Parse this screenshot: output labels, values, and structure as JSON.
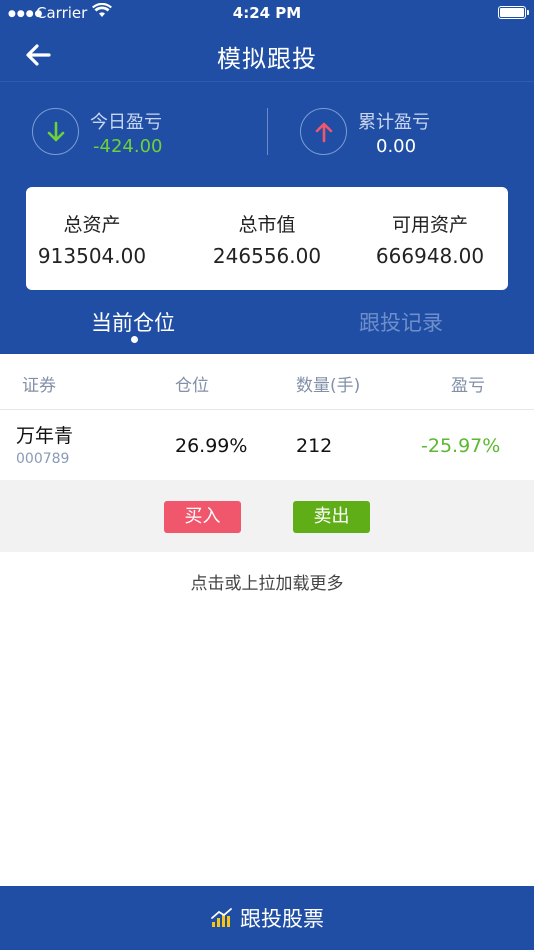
{
  "status_bar": {
    "carrier": "Carrier",
    "time": "4:24 PM"
  },
  "header": {
    "title": "模拟跟投"
  },
  "profit": {
    "today": {
      "label": "今日盈亏",
      "value": "-424.00",
      "icon": "arrow-down-icon",
      "color": "#6dd13a"
    },
    "total": {
      "label": "累计盈亏",
      "value": "0.00",
      "icon": "arrow-up-icon",
      "color": "#f0566c"
    }
  },
  "assets": [
    {
      "label": "总资产",
      "value": "913504.00"
    },
    {
      "label": "总市值",
      "value": "246556.00"
    },
    {
      "label": "可用资产",
      "value": "666948.00"
    }
  ],
  "tabs": [
    {
      "label": "当前仓位",
      "active": true
    },
    {
      "label": "跟投记录",
      "active": false
    }
  ],
  "table": {
    "headers": [
      "证券",
      "仓位",
      "数量(手)",
      "盈亏"
    ],
    "rows": [
      {
        "name": "万年青",
        "code": "000789",
        "position": "26.99%",
        "quantity": "212",
        "pl": "-25.97%"
      }
    ]
  },
  "actions": {
    "buy": "买入",
    "sell": "卖出"
  },
  "load_more": "点击或上拉加载更多",
  "bottom": {
    "label": "跟投股票",
    "icon": "chart-bars-icon"
  },
  "colors": {
    "primary": "#1f4ea4",
    "gain": "#5cb82f",
    "loss": "#f0566c",
    "buy": "#f0566c",
    "sell": "#5fae17"
  }
}
